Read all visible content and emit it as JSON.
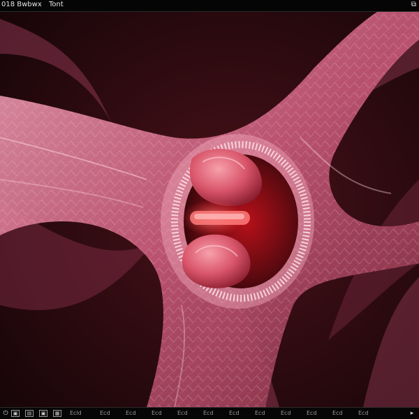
{
  "toolbar": {
    "left_label": "018 Bwbwx",
    "center_label": "Tont",
    "right_icon": "window-corner-icon"
  },
  "bottom_bar": {
    "icons": [
      "power-icon",
      "image-icon",
      "folder-icon",
      "image-icon",
      "grid-icon"
    ],
    "labels": [
      "Ecld",
      "Ecd",
      "Ecd",
      "Ecd",
      "Ecd",
      "Ecd",
      "Ecd",
      "Ecd",
      "Ecd",
      "Ecd",
      "Ecd",
      "Ecd"
    ],
    "right_icon": "cursor-icon"
  },
  "colors": {
    "background": "#2a0b10",
    "tissue": "#e37a9a",
    "highlight": "#ff5a5a"
  }
}
